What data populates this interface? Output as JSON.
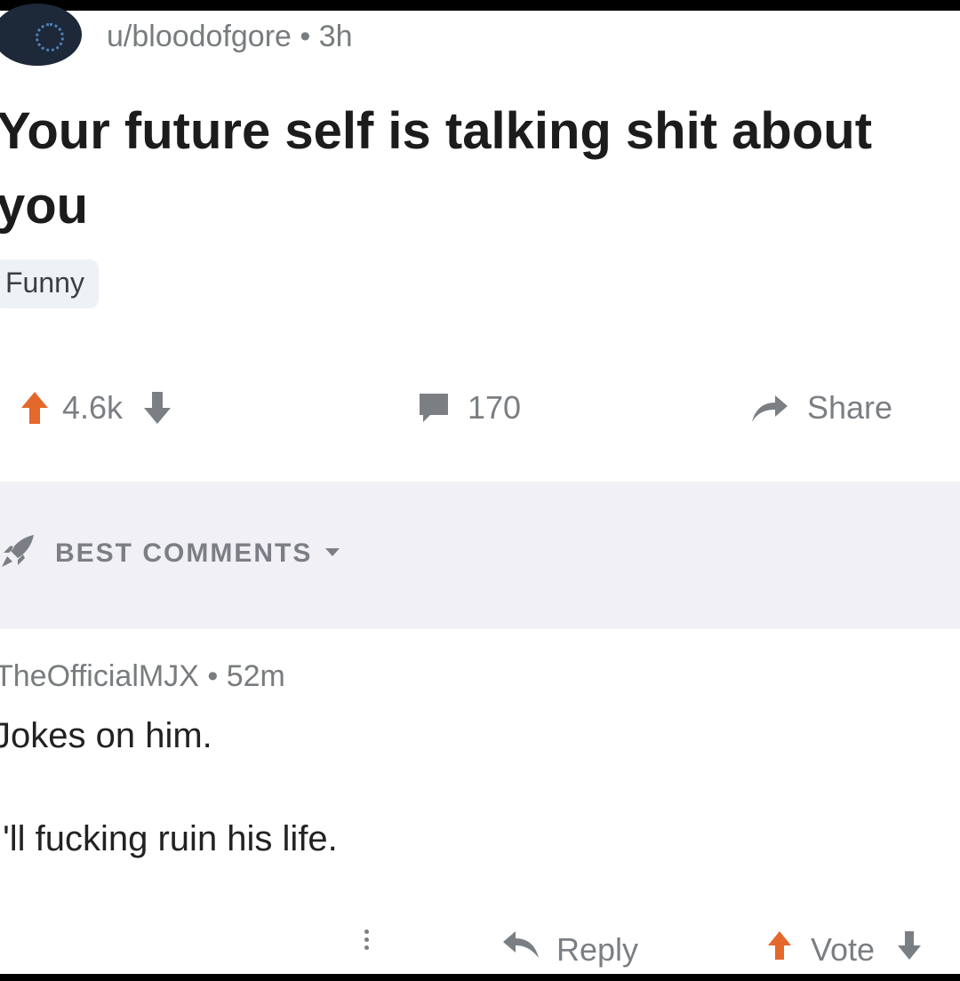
{
  "post": {
    "author": "u/bloodofgore",
    "separator": "•",
    "age": "3h",
    "title": "Your future self is talking shit about you",
    "flair": "Funny",
    "score": "4.6k",
    "comment_count": "170",
    "share_label": "Share"
  },
  "comments_section": {
    "sort_label": "BEST COMMENTS"
  },
  "comment": {
    "author": "TheOfficialMJX",
    "separator": "•",
    "age": "52m",
    "lines": [
      "Jokes on him.",
      "I'll fucking ruin his life."
    ],
    "reply_label": "Reply",
    "vote_label": "Vote"
  },
  "colors": {
    "upvote_active": "#e4672b",
    "icon_gray": "#7b7f83",
    "comments_bar": "#f1f0f5",
    "flair_bg": "#eef1f5"
  },
  "icons": [
    "avatar",
    "upvote-icon",
    "downvote-icon",
    "comment-bubble-icon",
    "share-arrow-icon",
    "rocket-icon",
    "chevron-down-icon",
    "more-dots-icon",
    "reply-icon"
  ]
}
